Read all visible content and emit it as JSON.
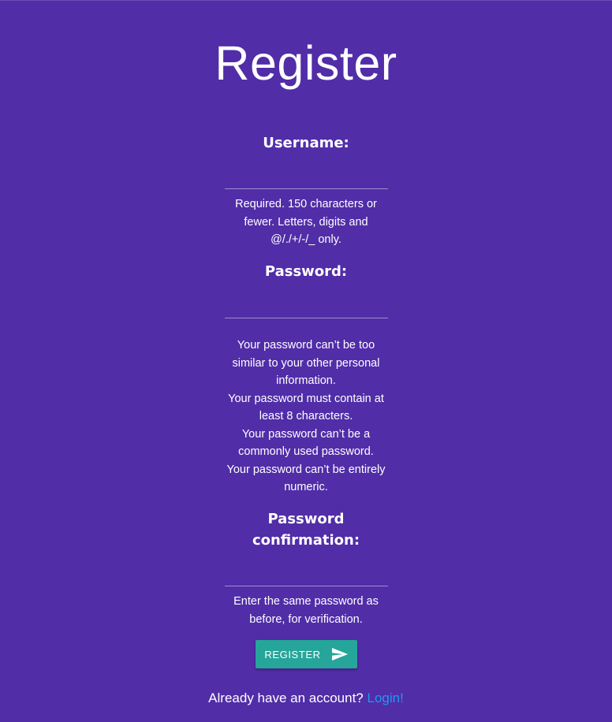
{
  "page": {
    "title": "Register"
  },
  "form": {
    "username": {
      "label": "Username:",
      "value": "",
      "help": "Required. 150 characters or fewer. Letters, digits and @/./+/-/_ only."
    },
    "password": {
      "label": "Password:",
      "value": "",
      "help": [
        "Your password can’t be too similar to your other personal information.",
        "Your password must contain at least 8 characters.",
        "Your password can’t be a commonly used password.",
        "Your password can’t be entirely numeric."
      ]
    },
    "password_confirmation": {
      "label": "Password confirmation:",
      "value": "",
      "help": "Enter the same password as before, for verification."
    },
    "submit": {
      "label": "Register",
      "icon": "send-icon"
    }
  },
  "footer": {
    "prompt": "Already have an account?",
    "link_label": "Login!"
  },
  "colors": {
    "background": "#512da8",
    "button": "#26a69a",
    "link": "#2196f3"
  }
}
